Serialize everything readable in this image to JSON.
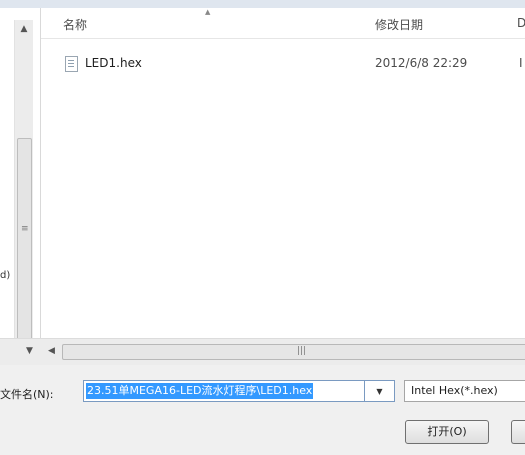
{
  "columns": {
    "name": "名称",
    "date_modified": "修改日期",
    "extra_partial": "DC"
  },
  "files": [
    {
      "name": "LED1.hex",
      "date": "2012/6/8 22:29",
      "extra": "I",
      "icon": "file-icon"
    }
  ],
  "filename": {
    "label": "文件名(N):",
    "value": "23.51单MEGA16-LED流水灯程序\\LED1.hex"
  },
  "file_type": {
    "selected": "Intel Hex(*.hex)"
  },
  "buttons": {
    "open": "打开(O)"
  },
  "left_pane": {
    "partial_label": "d)"
  },
  "colors": {
    "selection": "#3399ff",
    "background": "#f0f0f0"
  }
}
